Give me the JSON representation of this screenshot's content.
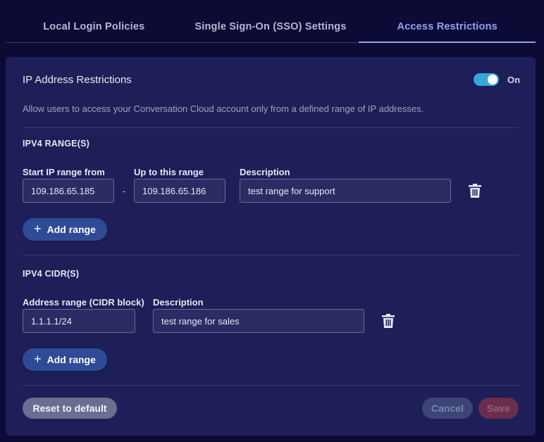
{
  "tabs": [
    {
      "label": "Local Login Policies"
    },
    {
      "label": "Single Sign-On (SSO) Settings"
    },
    {
      "label": "Access Restrictions"
    }
  ],
  "card": {
    "title": "IP Address Restrictions",
    "toggle_label": "On",
    "toggle_on": true,
    "description": "Allow users to access your Conversation Cloud account only from a defined range of IP addresses."
  },
  "ipv4_range": {
    "section_title": "IPV4 RANGE(S)",
    "start_label": "Start IP range from",
    "end_label": "Up to this range",
    "desc_label": "Description",
    "separator": "-",
    "row": {
      "start": "109.186.65.185",
      "end": "109.186.65.186",
      "description": "test range for support"
    },
    "add_label": "Add range"
  },
  "ipv4_cidr": {
    "section_title": "IPV4 CIDR(S)",
    "cidr_label": "Address range (CIDR block)",
    "desc_label": "Description",
    "row": {
      "cidr": "1.1.1.1/24",
      "description": "test range for sales"
    },
    "add_label": "Add range"
  },
  "footer": {
    "reset_label": "Reset to default",
    "cancel_label": "Cancel",
    "save_label": "Save"
  },
  "colors": {
    "background": "#0d0b36",
    "card": "#1e1f58",
    "accent": "#8ea4ec",
    "toggle": "#35a8d6",
    "primary_button": "#2f4b96"
  }
}
